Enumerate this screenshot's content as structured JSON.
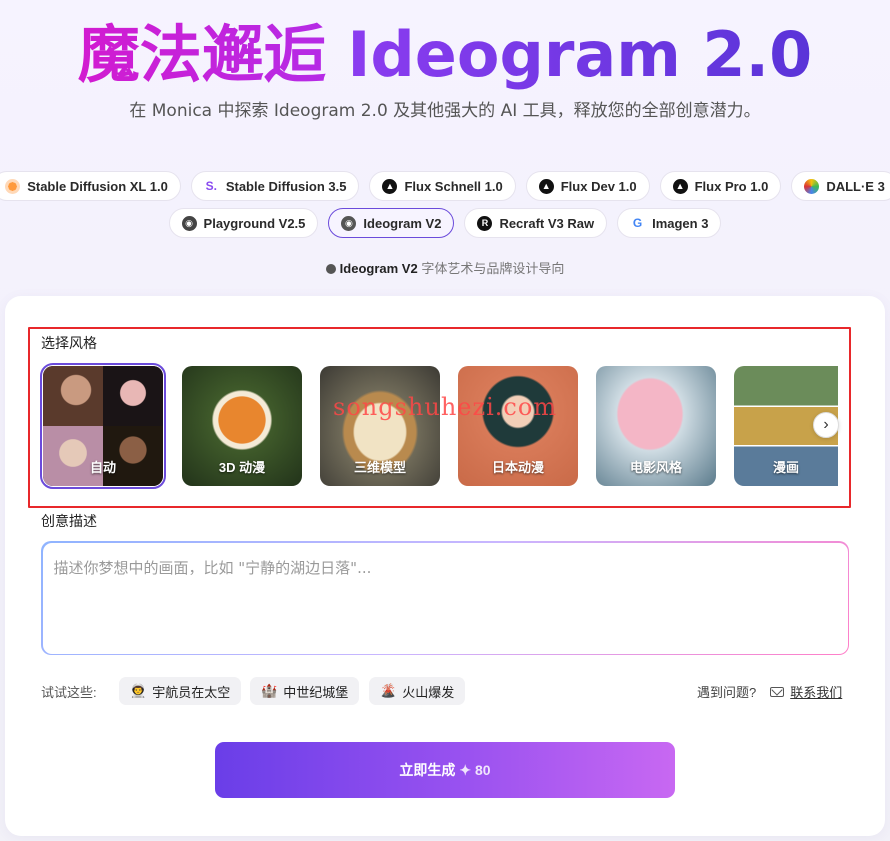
{
  "hero": {
    "title_cn": "魔法邂逅",
    "title_en": "Ideogram 2.0",
    "subtitle": "在 Monica 中探索 Ideogram 2.0 及其他强大的 AI 工具，释放您的全部创意潜力。"
  },
  "models": {
    "row1": [
      {
        "label": "Stable Diffusion XL 1.0",
        "icon": "stable-diffusion-icon"
      },
      {
        "label": "Stable Diffusion 3.5",
        "icon": "s-letter-icon"
      },
      {
        "label": "Flux Schnell 1.0",
        "icon": "flux-icon"
      },
      {
        "label": "Flux Dev 1.0",
        "icon": "flux-icon"
      },
      {
        "label": "Flux Pro 1.0",
        "icon": "flux-icon"
      },
      {
        "label": "DALL·E 3",
        "icon": "dalle-icon"
      }
    ],
    "row2": [
      {
        "label": "Playground V2.5",
        "icon": "playground-icon"
      },
      {
        "label": "Ideogram V2",
        "icon": "ideogram-icon",
        "selected": true
      },
      {
        "label": "Recraft V3 Raw",
        "icon": "recraft-icon"
      },
      {
        "label": "Imagen 3",
        "icon": "google-icon"
      }
    ],
    "hint_name": "Ideogram V2",
    "hint_desc": "字体艺术与品牌设计导向"
  },
  "style": {
    "label": "选择风格",
    "cards": [
      {
        "name": "自动",
        "selected": true
      },
      {
        "name": "3D 动漫"
      },
      {
        "name": "三维模型"
      },
      {
        "name": "日本动漫"
      },
      {
        "name": "电影风格"
      },
      {
        "name": "漫画"
      }
    ],
    "next_icon": "chevron-right-icon"
  },
  "watermark": "songshuhezi.com",
  "description": {
    "label": "创意描述",
    "placeholder": "描述你梦想中的画面，比如 \"宁静的湖边日落\"..."
  },
  "try": {
    "label": "试试这些:",
    "chips": [
      {
        "emoji": "👨‍🚀",
        "label": "宇航员在太空"
      },
      {
        "emoji": "🏰",
        "label": "中世纪城堡"
      },
      {
        "emoji": "🌋",
        "label": "火山爆发"
      }
    ]
  },
  "help": {
    "question": "遇到问题?",
    "contact": "联系我们"
  },
  "generate": {
    "label": "立即生成",
    "cost": "✦ 80"
  },
  "colors": {
    "accent": "#6b4bdb",
    "highlight_border": "#e8282b",
    "button_start": "#6a3ee8",
    "button_end": "#c868f2"
  }
}
